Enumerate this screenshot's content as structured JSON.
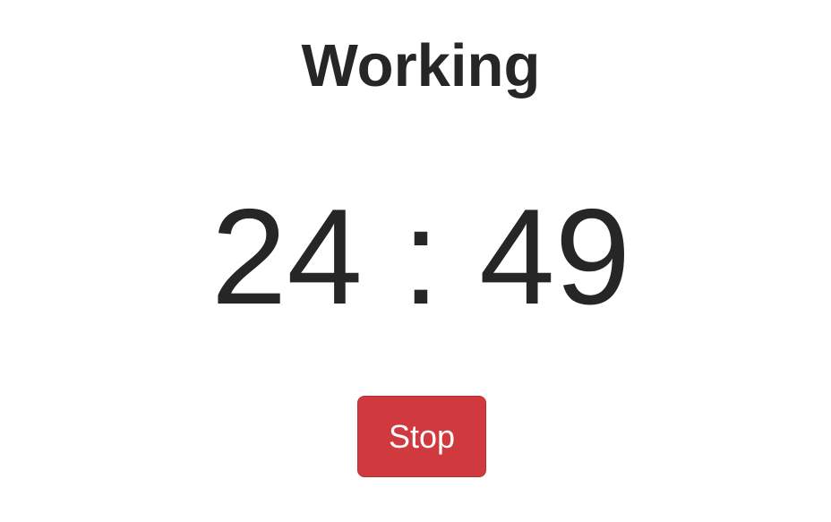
{
  "status": {
    "title": "Working"
  },
  "timer": {
    "minutes": "24",
    "separator": ":",
    "seconds": "49"
  },
  "controls": {
    "stop_label": "Stop",
    "stop_color": "#d0393d"
  }
}
